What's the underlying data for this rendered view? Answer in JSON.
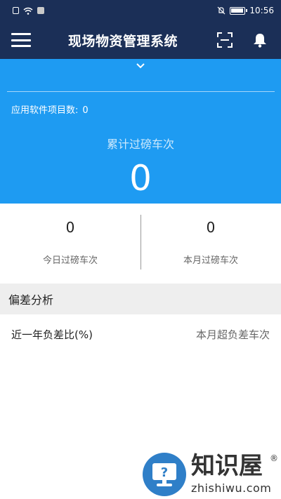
{
  "status_bar": {
    "time": "10:56",
    "icons": [
      "alert-icon",
      "wifi-icon",
      "app-thumbnail-icon",
      "mute-icon",
      "battery-icon"
    ]
  },
  "app_bar": {
    "title": "现场物资管理系统",
    "icons": [
      "menu-icon",
      "scan-icon",
      "bell-icon"
    ]
  },
  "hero": {
    "project_count_label": "应用软件项目数:",
    "project_count_value": "0",
    "total_label": "累计过磅车次",
    "total_value": "0",
    "background": "#1e9bf2"
  },
  "stats": [
    {
      "value": "0",
      "label": "今日过磅车次"
    },
    {
      "value": "0",
      "label": "本月过磅车次"
    }
  ],
  "section": {
    "title": "偏差分析",
    "row_left": "近一年负差比(%)",
    "row_right": "本月超负差车次"
  },
  "watermark": {
    "title": "知识屋",
    "registered": "®",
    "domain": "zhishiwu.com"
  },
  "colors": {
    "nav": "#1b2f57",
    "accent": "#1e9bf2"
  }
}
